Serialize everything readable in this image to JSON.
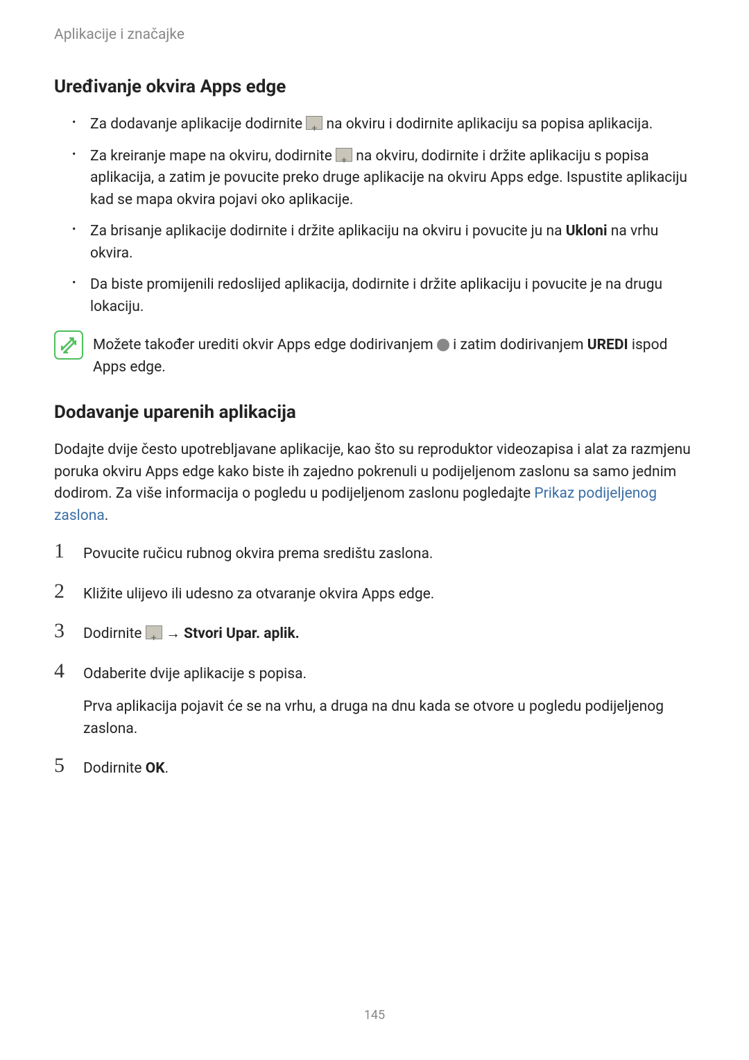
{
  "header": {
    "title": "Aplikacije i značajke"
  },
  "section1": {
    "heading": "Uređivanje okvira Apps edge",
    "bullets": [
      {
        "pre": "Za dodavanje aplikacije dodirnite ",
        "post": " na okviru i dodirnite aplikaciju sa popisa aplikacija."
      },
      {
        "pre": "Za kreiranje mape na okviru, dodirnite ",
        "post": " na okviru, dodirnite i držite aplikaciju s popisa aplikacija, a zatim je povucite preko druge aplikacije na okviru Apps edge. Ispustite aplikaciju kad se mapa okvira pojavi oko aplikacije."
      },
      {
        "text_a": "Za brisanje aplikacije dodirnite i držite aplikaciju na okviru i povucite ju na ",
        "bold": "Ukloni",
        "text_b": " na vrhu okvira."
      },
      {
        "text": "Da biste promijenili redoslijed aplikacija, dodirnite i držite aplikaciju i povucite je na drugu lokaciju."
      }
    ],
    "note": {
      "pre": "Možete također urediti okvir Apps edge dodirivanjem ",
      "mid": " i zatim dodirivanjem ",
      "bold": "UREDI",
      "post": " ispod Apps edge."
    }
  },
  "section2": {
    "heading": "Dodavanje uparenih aplikacija",
    "paragraph": {
      "a": "Dodajte dvije često upotrebljavane aplikacije, kao što su reproduktor videozapisa i alat za razmjenu poruka okviru Apps edge kako biste ih zajedno pokrenuli u podijeljenom zaslonu sa samo jednim dodirom. Za više informacija o pogledu u podijeljenom zaslonu pogledajte ",
      "link": "Prikaz podijeljenog zaslona",
      "b": "."
    },
    "steps": [
      {
        "num": "1",
        "text": "Povucite ručicu rubnog okvira prema središtu zaslona."
      },
      {
        "num": "2",
        "text": "Kližite ulijevo ili udesno za otvaranje okvira Apps edge."
      },
      {
        "num": "3",
        "pre": "Dodirnite ",
        "arrow": " → ",
        "bold": "Stvori Upar. aplik."
      },
      {
        "num": "4",
        "text": "Odaberite dvije aplikacije s popisa.",
        "extra": "Prva aplikacija pojavit će se na vrhu, a druga na dnu kada se otvore u pogledu podijeljenog zaslona."
      },
      {
        "num": "5",
        "pre": "Dodirnite ",
        "bold": "OK",
        "post": "."
      }
    ]
  },
  "page_number": "145"
}
